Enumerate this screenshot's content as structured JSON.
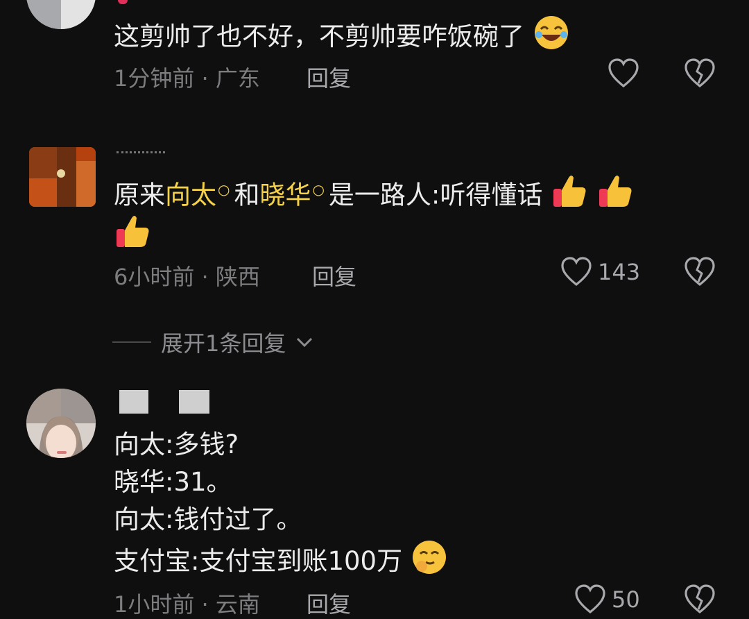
{
  "comments": [
    {
      "text": "这剪帅了也不好，不剪帅要咋饭碗了",
      "time_location": "1分钟前 · 广东",
      "reply_label": "回复",
      "likes": ""
    },
    {
      "text_prefix": "原来",
      "highlight1": "向太",
      "text_mid": "和",
      "highlight2": "晓华",
      "text_suffix": "是一路人:听得懂话",
      "time_location": "6小时前 · 陕西",
      "reply_label": "回复",
      "likes": "143"
    },
    {
      "lines": [
        "向太:多钱?",
        "晓华:31。",
        "向太:钱付过了。",
        "支付宝:支付宝到账100万"
      ],
      "time_location": "1小时前 · 云南",
      "reply_label": "回复",
      "likes": "50"
    }
  ],
  "expand_replies_label": "展开1条回复",
  "icons": [
    "heart-icon",
    "broken-heart-icon",
    "search-mark-icon",
    "chevron-down-icon",
    "emoji-laughing",
    "emoji-thumbs-up",
    "emoji-smirk"
  ],
  "colors": {
    "background": "#0f0f10",
    "highlight": "#f5d24a"
  }
}
